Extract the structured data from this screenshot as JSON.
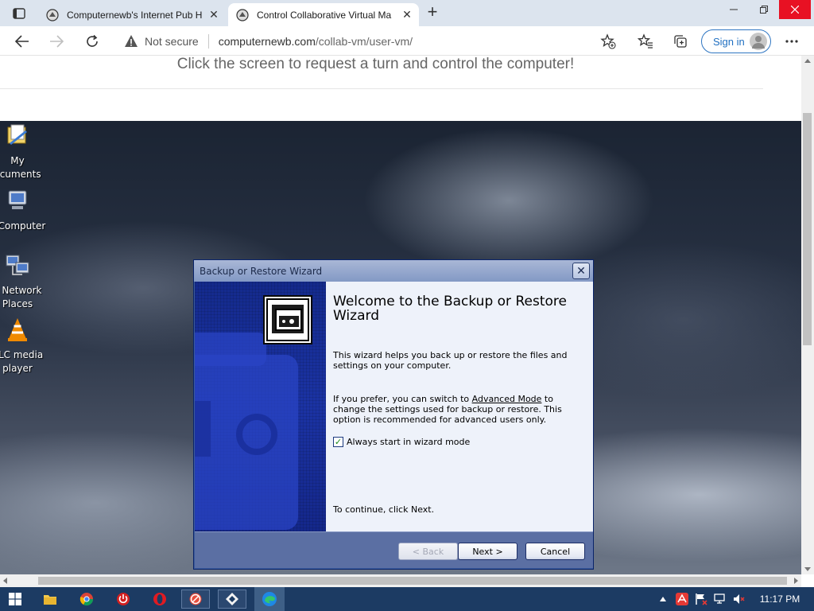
{
  "browser": {
    "tabs": [
      {
        "title": "Computernewb's Internet Pub H",
        "active": false
      },
      {
        "title": "Control Collaborative Virtual Ma",
        "active": true
      }
    ],
    "address": {
      "security_label": "Not secure",
      "url_host": "computernewb.com",
      "url_path": "/collab-vm/user-vm/"
    },
    "signin_label": "Sign in",
    "icons": {
      "tab_actions": "tab-actions-icon",
      "favicon": "computernewb-favicon",
      "back": "back-arrow-icon",
      "forward": "forward-arrow-icon",
      "refresh": "refresh-icon",
      "warning": "warning-triangle-icon",
      "add_favorite": "star-plus-icon",
      "favorites": "favorites-list-icon",
      "collections": "collections-icon",
      "more": "more-dots-icon"
    }
  },
  "page": {
    "instruction": "Click the screen to request a turn and control the computer!"
  },
  "vm": {
    "desktop_icons": [
      {
        "label_line1": "My",
        "label_line2": "ocuments",
        "icon": "my-documents-icon"
      },
      {
        "label_line1": "y Computer",
        "label_line2": "",
        "icon": "my-computer-icon"
      },
      {
        "label_line1": "y Network",
        "label_line2": "Places",
        "icon": "network-places-icon"
      },
      {
        "label_line1": "VLC media",
        "label_line2": "player",
        "icon": "vlc-icon"
      }
    ],
    "dialog": {
      "title": "Backup or Restore Wizard",
      "close_label": "✕",
      "heading": "Welcome to the Backup or Restore Wizard",
      "para1": "This wizard helps you back up or restore the files and settings on your computer.",
      "para2_prefix": "If you prefer, you can switch to ",
      "para2_link": "Advanced Mode",
      "para2_suffix": " to change the settings used for backup or restore. This option is recommended for advanced users only.",
      "checkbox_label": "Always start in wizard mode",
      "checkbox_checked": true,
      "continue_text": "To continue, click Next.",
      "buttons": {
        "back": "< Back",
        "next": "Next >",
        "cancel": "Cancel"
      }
    }
  },
  "taskbar": {
    "time": "11:17 PM",
    "apps": [
      "file-explorer-icon",
      "chrome-icon",
      "power-app-icon",
      "opera-icon",
      "no-entry-app-icon",
      "vm-app-icon",
      "edge-icon"
    ],
    "tray_icons": [
      "show-hidden-icons-chevron",
      "antivirus-icon",
      "flag-icon",
      "network-icon",
      "volume-muted-icon"
    ]
  },
  "colors": {
    "tabstrip_bg": "#dce4ee",
    "taskbar_bg": "#1c3b63",
    "dialog_side": "#1b33a4",
    "dialog_body": "#eef2fa",
    "accent": "#1f6fc1",
    "close_red": "#e81123"
  }
}
